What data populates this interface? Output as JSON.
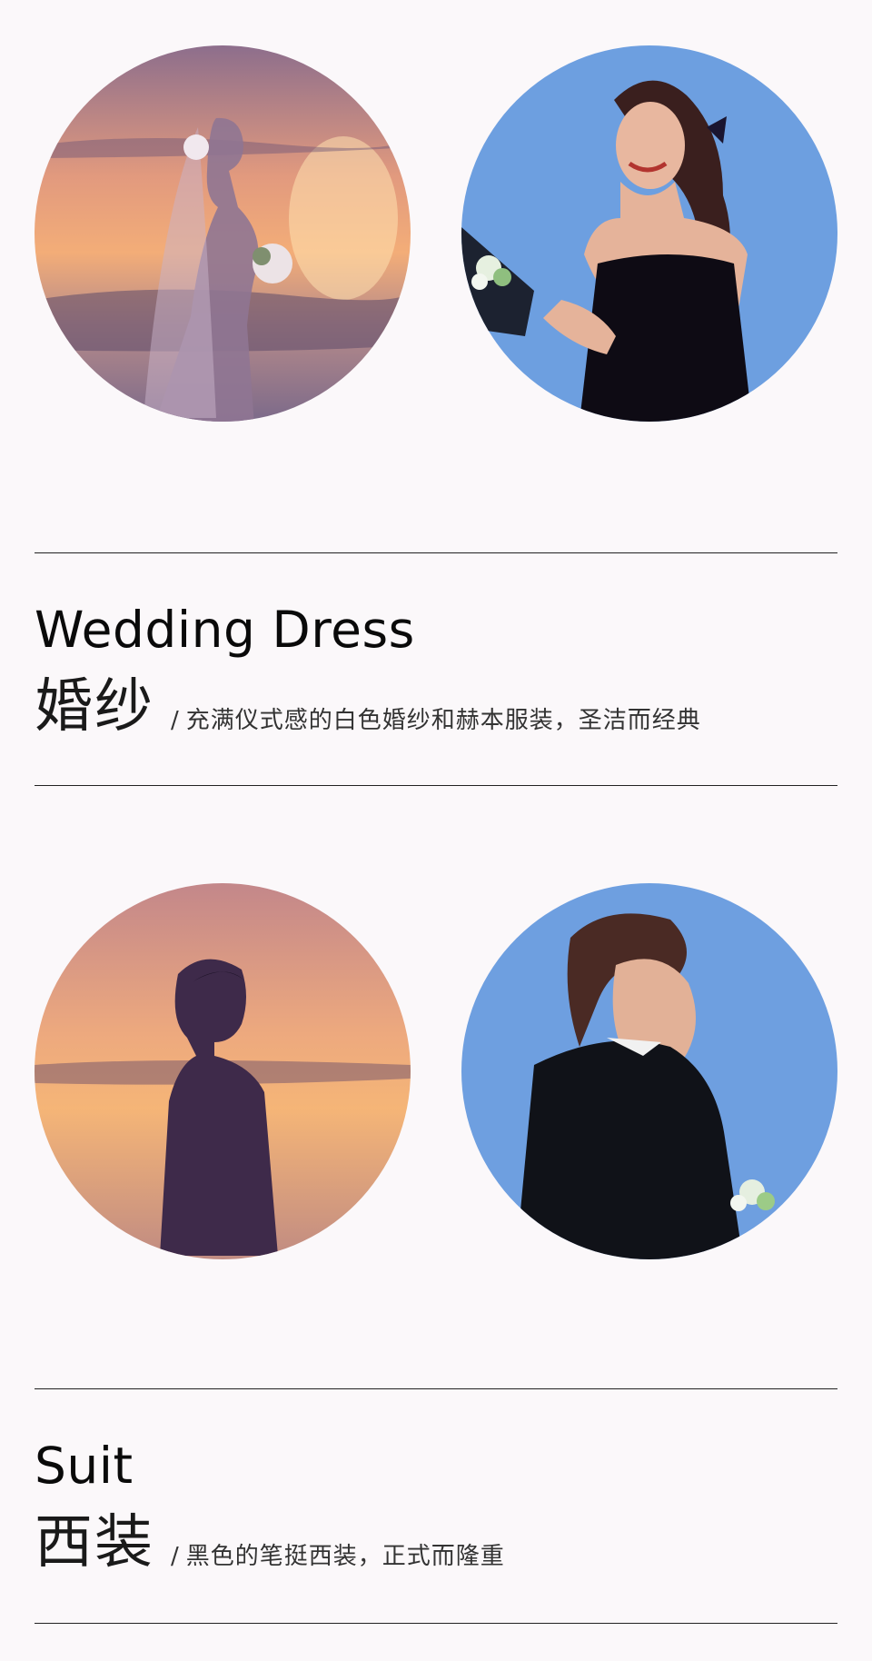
{
  "sections": [
    {
      "title_en": "Wedding Dress",
      "title_cn": "婚纱",
      "separator": "/",
      "description": "充满仪式感的白色婚纱和赫本服装，圣洁而经典"
    },
    {
      "title_en": "Suit",
      "title_cn": "西装",
      "separator": "/",
      "description": "黑色的笔挺西装，正式而隆重"
    }
  ],
  "colors": {
    "background": "#fbf8fa",
    "sunset_top": "#8a6c86",
    "sunset_glow": "#f0a878",
    "sky_blue": "#6b9ee0",
    "divider": "#222222"
  }
}
